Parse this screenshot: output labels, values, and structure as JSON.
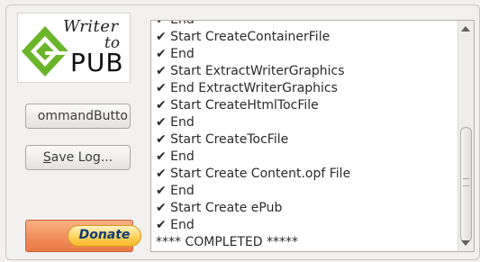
{
  "logo": {
    "line1": "Writer",
    "line2": "to",
    "line3": "PUB"
  },
  "buttons": {
    "command_label": "ommandButto",
    "save_log_label": "Save Log...",
    "save_log_mnemonic": "S",
    "save_log_rest": "ave Log...",
    "donate_label": "Donate"
  },
  "log": {
    "lines": [
      "✔ End",
      "✔ Start CreateContainerFile",
      "✔ End",
      "✔ Start ExtractWriterGraphics",
      "✔ End ExtractWriterGraphics",
      "✔ Start CreateHtmlTocFile",
      "✔ End",
      "✔ Start CreateTocFile",
      "✔ End",
      "✔ Start Create Content.opf File",
      "✔ End",
      "✔ Start Create ePub",
      "✔ End",
      "**** COMPLETED *****"
    ]
  },
  "colors": {
    "logo_green": "#6bb52b",
    "donate_orange": "#ef8b5a",
    "donate_text": "#0d3a78"
  }
}
